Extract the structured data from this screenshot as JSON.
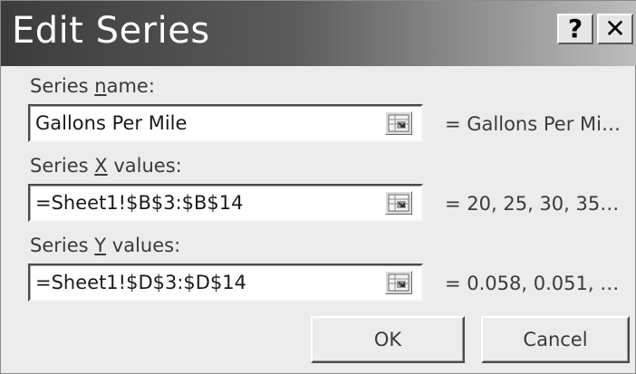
{
  "dialog": {
    "title": "Edit Series",
    "help_label": "?",
    "close_label": "✕"
  },
  "series_name": {
    "label_pre": "Series ",
    "label_accel": "n",
    "label_post": "ame:",
    "value": "Gallons Per Mile",
    "preview": "= Gallons Per Mi…"
  },
  "series_x": {
    "label_pre": "Series ",
    "label_accel": "X",
    "label_post": " values:",
    "value": "=Sheet1!$B$3:$B$14",
    "preview": "= 20, 25, 30, 35…"
  },
  "series_y": {
    "label_pre": "Series ",
    "label_accel": "Y",
    "label_post": " values:",
    "value": "=Sheet1!$D$3:$D$14",
    "preview": "= 0.058, 0.051, …"
  },
  "buttons": {
    "ok": "OK",
    "cancel": "Cancel"
  },
  "icons": {
    "collapse_dialog": "range-selector-icon",
    "help": "help-icon",
    "close": "close-icon"
  }
}
